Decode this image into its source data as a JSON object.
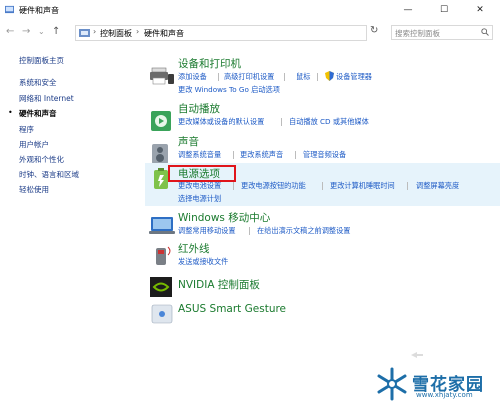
{
  "window": {
    "title": "硬件和声音",
    "minimize": "—",
    "maximize": "☐",
    "close": "✕"
  },
  "address": {
    "crumbs": [
      "控制面板",
      "硬件和声音"
    ],
    "separator": "›",
    "search_placeholder": "搜索控制面板"
  },
  "nav": {
    "back": "←",
    "forward": "→",
    "down": "⌄",
    "up": "↑",
    "refresh": "↻"
  },
  "sidebar": {
    "items": [
      {
        "label": "控制面板主页"
      },
      {
        "label": "系统和安全"
      },
      {
        "label": "网络和 Internet"
      },
      {
        "label": "硬件和声音"
      },
      {
        "label": "程序"
      },
      {
        "label": "用户帐户"
      },
      {
        "label": "外观和个性化"
      },
      {
        "label": "时钟、语言和区域"
      },
      {
        "label": "轻松使用"
      }
    ],
    "bullet": "•"
  },
  "sections": [
    {
      "title": "设备和打印机",
      "links": [
        "添加设备",
        "高级打印机设置",
        "鼠标",
        "设备管理器",
        "更改 Windows To Go 启动选项"
      ]
    },
    {
      "title": "自动播放",
      "links": [
        "更改媒体或设备的默认设置",
        "自动播放 CD 或其他媒体"
      ]
    },
    {
      "title": "声音",
      "links": [
        "调整系统音量",
        "更改系统声音",
        "管理音频设备"
      ]
    },
    {
      "title": "电源选项",
      "links": [
        "更改电池设置",
        "更改电源按钮的功能",
        "更改计算机睡眠时间",
        "调整屏幕亮度",
        "选择电源计划"
      ]
    },
    {
      "title": "Windows 移动中心",
      "links": [
        "调整常用移动设置",
        "在给出演示文稿之前调整设置"
      ]
    },
    {
      "title": "红外线",
      "links": [
        "发送或接收文件"
      ]
    },
    {
      "title": "NVIDIA 控制面板",
      "links": []
    },
    {
      "title": "ASUS Smart Gesture",
      "links": []
    }
  ],
  "watermark": {
    "text": "雪花家园",
    "url": "www.xhjaty.com"
  },
  "colors": {
    "link": "#1e5bc6",
    "title_green": "#1a7a2e",
    "highlight": "#e6f3fb",
    "red_box": "#e0151b",
    "watermark": "#1d6ea8"
  }
}
